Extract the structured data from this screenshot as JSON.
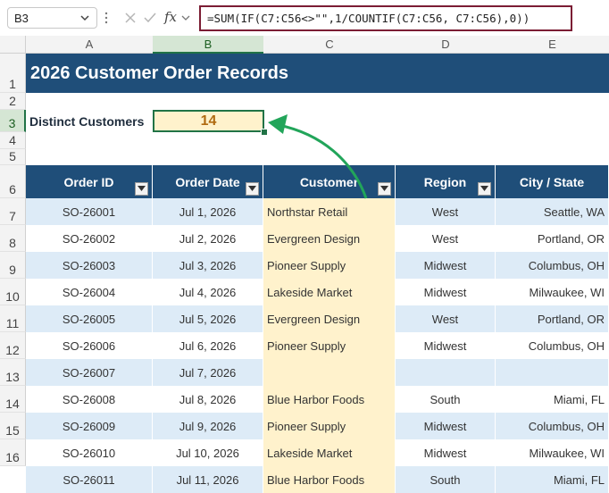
{
  "formula_bar": {
    "name_box": "B3",
    "fx_label": "fx",
    "formula": "=SUM(IF(C7:C56<>\"\",1/COUNTIF(C7:C56, C7:C56),0))"
  },
  "columns": [
    "A",
    "B",
    "C",
    "D",
    "E"
  ],
  "row_numbers": [
    "1",
    "2",
    "3",
    "4",
    "5",
    "6",
    "7",
    "8",
    "9",
    "10",
    "11",
    "12",
    "13",
    "14",
    "15",
    "16"
  ],
  "sheet": {
    "title": "2026 Customer Order Records",
    "distinct_label": "Distinct Customers",
    "distinct_value": "14",
    "headers": [
      "Order ID",
      "Order Date",
      "Customer",
      "Region",
      "City / State"
    ],
    "rows": [
      [
        "SO-26001",
        "Jul 1, 2026",
        "Northstar Retail",
        "West",
        "Seattle, WA"
      ],
      [
        "SO-26002",
        "Jul 2, 2026",
        "Evergreen Design",
        "West",
        "Portland, OR"
      ],
      [
        "SO-26003",
        "Jul 3, 2026",
        "Pioneer Supply",
        "Midwest",
        "Columbus, OH"
      ],
      [
        "SO-26004",
        "Jul 4, 2026",
        "Lakeside Market",
        "Midwest",
        "Milwaukee, WI"
      ],
      [
        "SO-26005",
        "Jul 5, 2026",
        "Evergreen Design",
        "West",
        "Portland, OR"
      ],
      [
        "SO-26006",
        "Jul 6, 2026",
        "Pioneer Supply",
        "Midwest",
        "Columbus, OH"
      ],
      [
        "SO-26007",
        "Jul 7, 2026",
        "",
        "",
        ""
      ],
      [
        "SO-26008",
        "Jul 8, 2026",
        "Blue Harbor Foods",
        "South",
        "Miami, FL"
      ],
      [
        "SO-26009",
        "Jul 9, 2026",
        "Pioneer Supply",
        "Midwest",
        "Columbus, OH"
      ],
      [
        "SO-26010",
        "Jul 10, 2026",
        "Lakeside Market",
        "Midwest",
        "Milwaukee, WI"
      ],
      [
        "SO-26011",
        "Jul 11, 2026",
        "Blue Harbor Foods",
        "South",
        "Miami, FL"
      ]
    ]
  },
  "colors": {
    "header_blue": "#1f4e79",
    "row_band": "#ddebf7",
    "customer_fill": "#fff2cc",
    "selection_green": "#217346",
    "arrow_green": "#22a55a",
    "formula_border": "#7b1d34"
  },
  "icons": {
    "cancel": "x-icon",
    "enter": "check-icon",
    "filter": "filter-dropdown-icon"
  }
}
